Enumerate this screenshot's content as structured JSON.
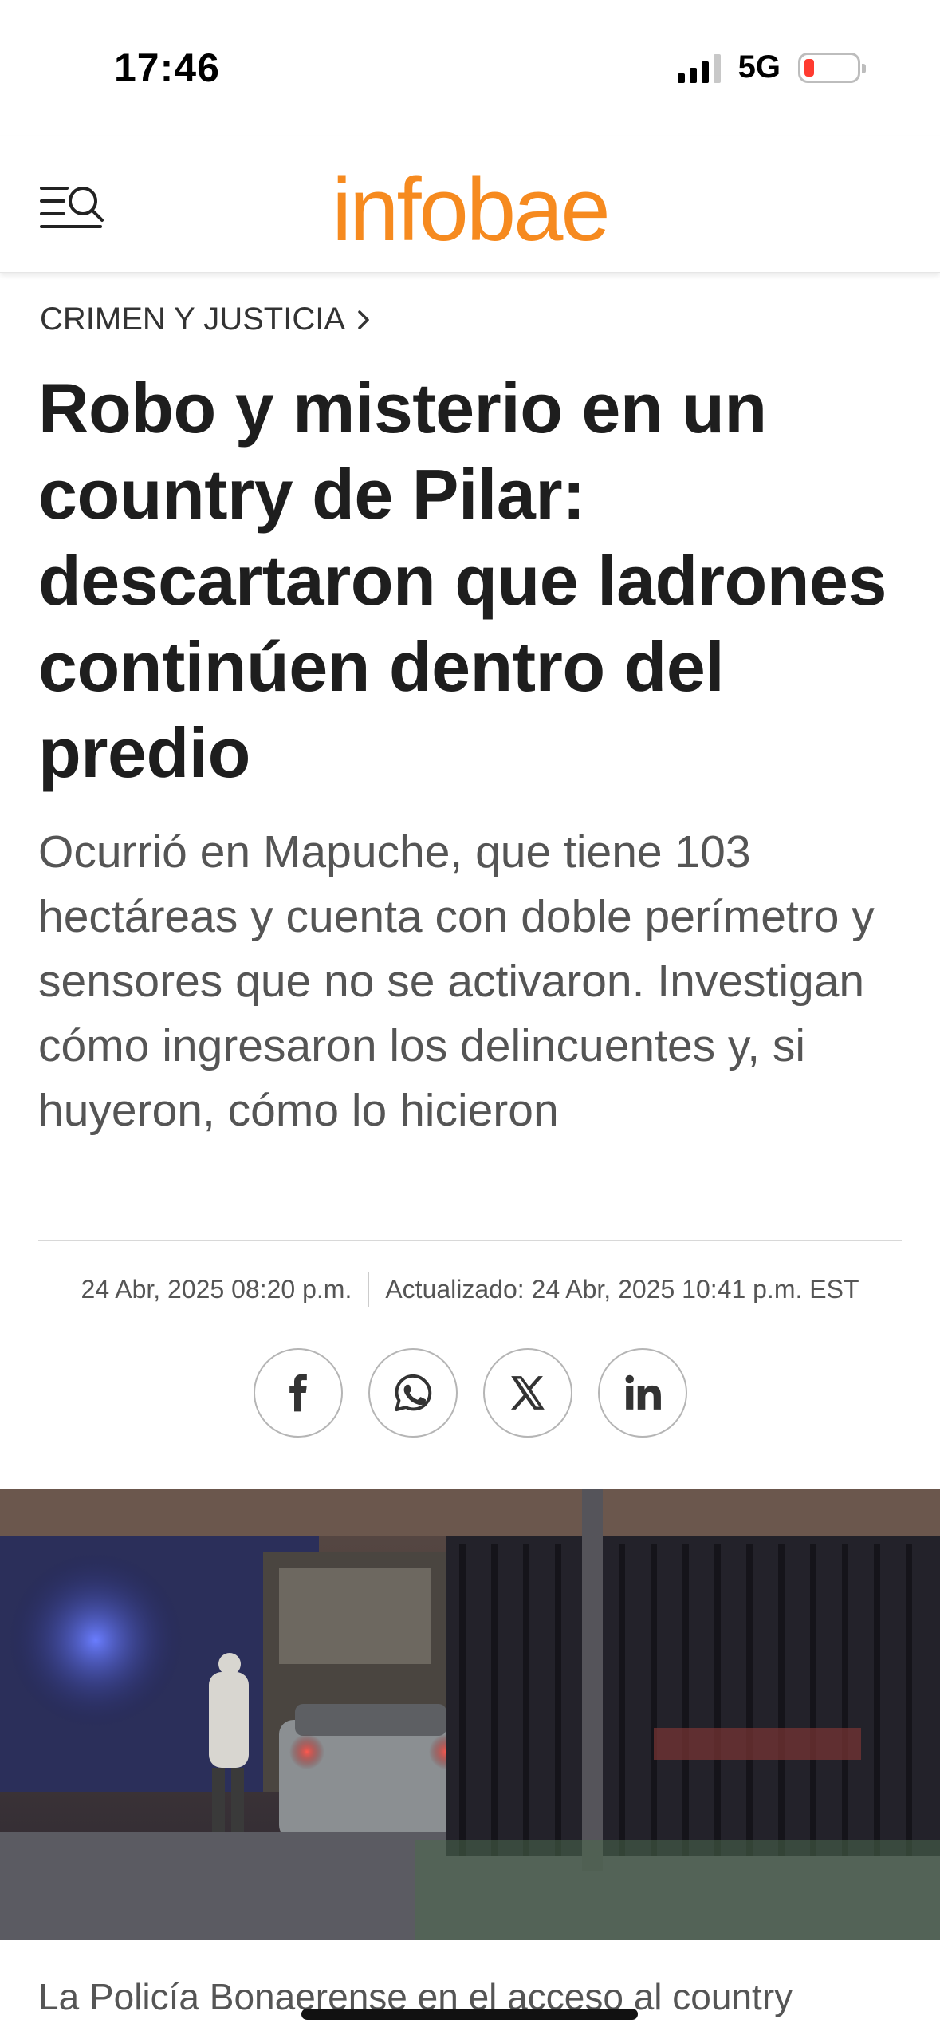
{
  "status_bar": {
    "time": "17:46",
    "network": "5G",
    "battery_level_percent": 10,
    "signal_bars_active": 3
  },
  "header": {
    "logo": "infobae",
    "logo_color": "#f68a1f",
    "menu_icon": "menu-search-icon"
  },
  "article": {
    "section": "CRIMEN Y JUSTICIA",
    "headline": "Robo y misterio en un country de Pilar: descartaron que ladrones continúen dentro del predio",
    "subtitle": "Ocurrió en Mapuche, que tiene 103 hectáreas y cuenta con doble perímetro y sensores que no se activaron. Investigan cómo ingresaron los delincuentes y, si huyeron, cómo lo hicieron",
    "published": "24 Abr, 2025 08:20 p.m.",
    "updated": "Actualizado: 24 Abr, 2025 10:41 p.m. EST",
    "share": [
      {
        "network": "facebook",
        "icon": "facebook-icon"
      },
      {
        "network": "whatsapp",
        "icon": "whatsapp-icon"
      },
      {
        "network": "x",
        "icon": "x-icon"
      },
      {
        "network": "linkedin",
        "icon": "linkedin-icon"
      }
    ],
    "image_caption": "La Policía Bonaerense en el acceso al country"
  }
}
